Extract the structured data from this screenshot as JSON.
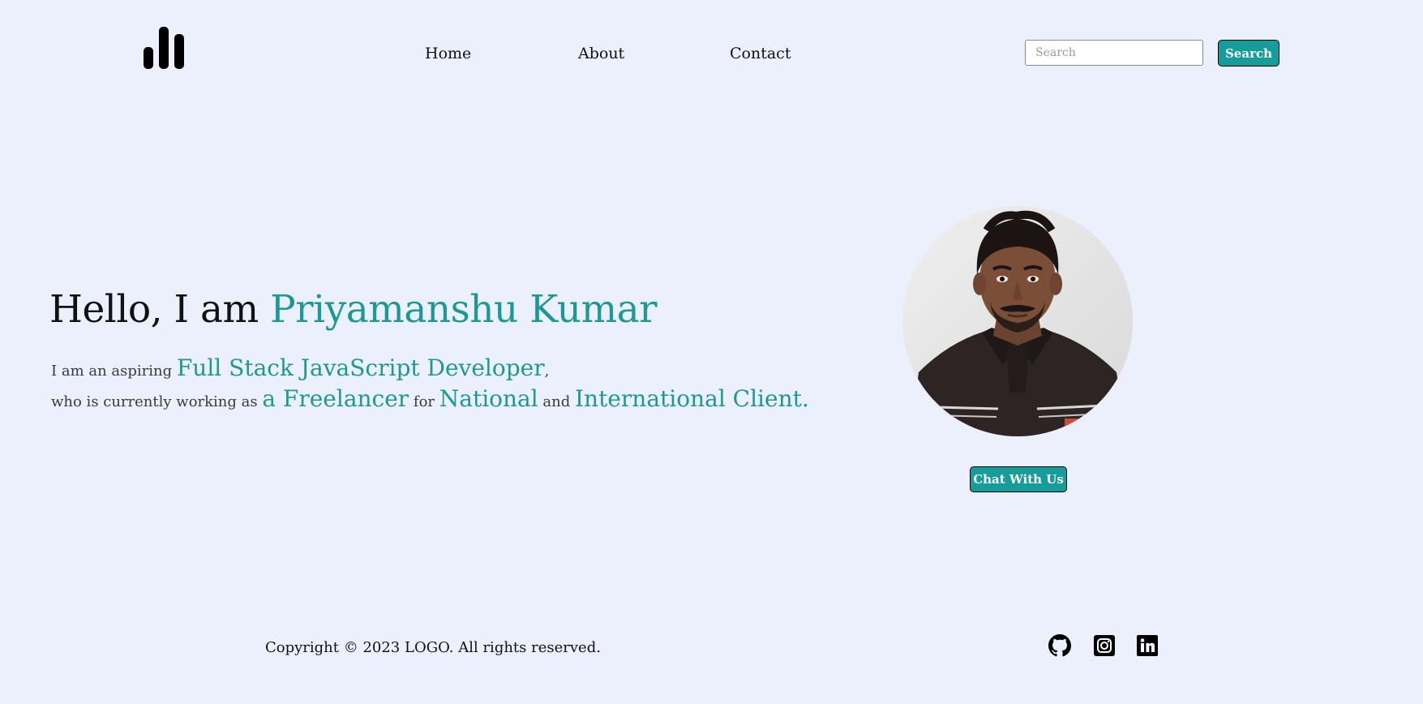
{
  "nav": {
    "links": [
      "Home",
      "About",
      "Contact"
    ],
    "search_placeholder": "Search",
    "search_button": "Search"
  },
  "hero": {
    "greeting": "Hello, I am ",
    "name": "Priyamanshu Kumar",
    "line1": {
      "prefix": "I am an aspiring ",
      "role": "Full Stack JavaScript Developer",
      "suffix": ","
    },
    "line2": {
      "prefix": "who is currently working as ",
      "highlight1": "a Freelancer",
      "mid1": " for ",
      "highlight2": "National",
      "mid2": " and ",
      "highlight3": "International Client."
    },
    "chat_button": "Chat With Us"
  },
  "footer": {
    "copyright": "Copyright © 2023 LOGO. All rights reserved.",
    "social_icons": [
      "github-icon",
      "instagram-icon",
      "linkedin-icon"
    ]
  },
  "colors": {
    "background": "#ECF0FC",
    "accent": "#1C9896",
    "button": "#169C9B"
  }
}
